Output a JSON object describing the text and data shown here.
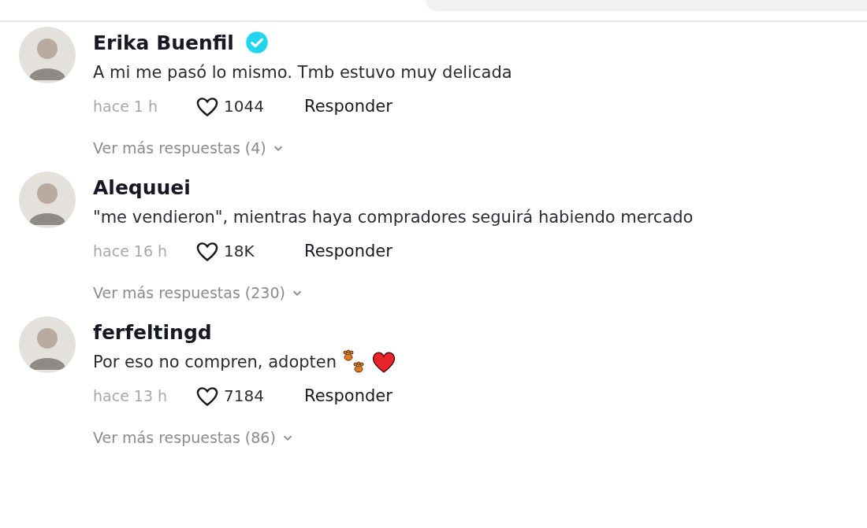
{
  "comments": [
    {
      "author": "Erika Buenfil",
      "verified": true,
      "text": "A mi me pasó lo mismo. Tmb estuvo muy delicada",
      "time": "hace 1 h",
      "likes": "1044",
      "reply": "Responder",
      "more_replies": "Ver más respuestas (4)"
    },
    {
      "author": "Alequuei",
      "verified": false,
      "text": "\"me vendieron\", mientras haya compradores seguirá habiendo mercado",
      "time": "hace 16 h",
      "likes": "18K",
      "reply": "Responder",
      "more_replies": "Ver más respuestas (230)"
    },
    {
      "author": "ferfeltingd",
      "verified": false,
      "text": "Por eso no compren, adopten",
      "trailing_icons": [
        {
          "kind": "paws"
        },
        {
          "kind": "heart"
        }
      ],
      "time": "hace 13 h",
      "likes": "7184",
      "reply": "Responder",
      "more_replies": "Ver más respuestas (86)"
    }
  ]
}
